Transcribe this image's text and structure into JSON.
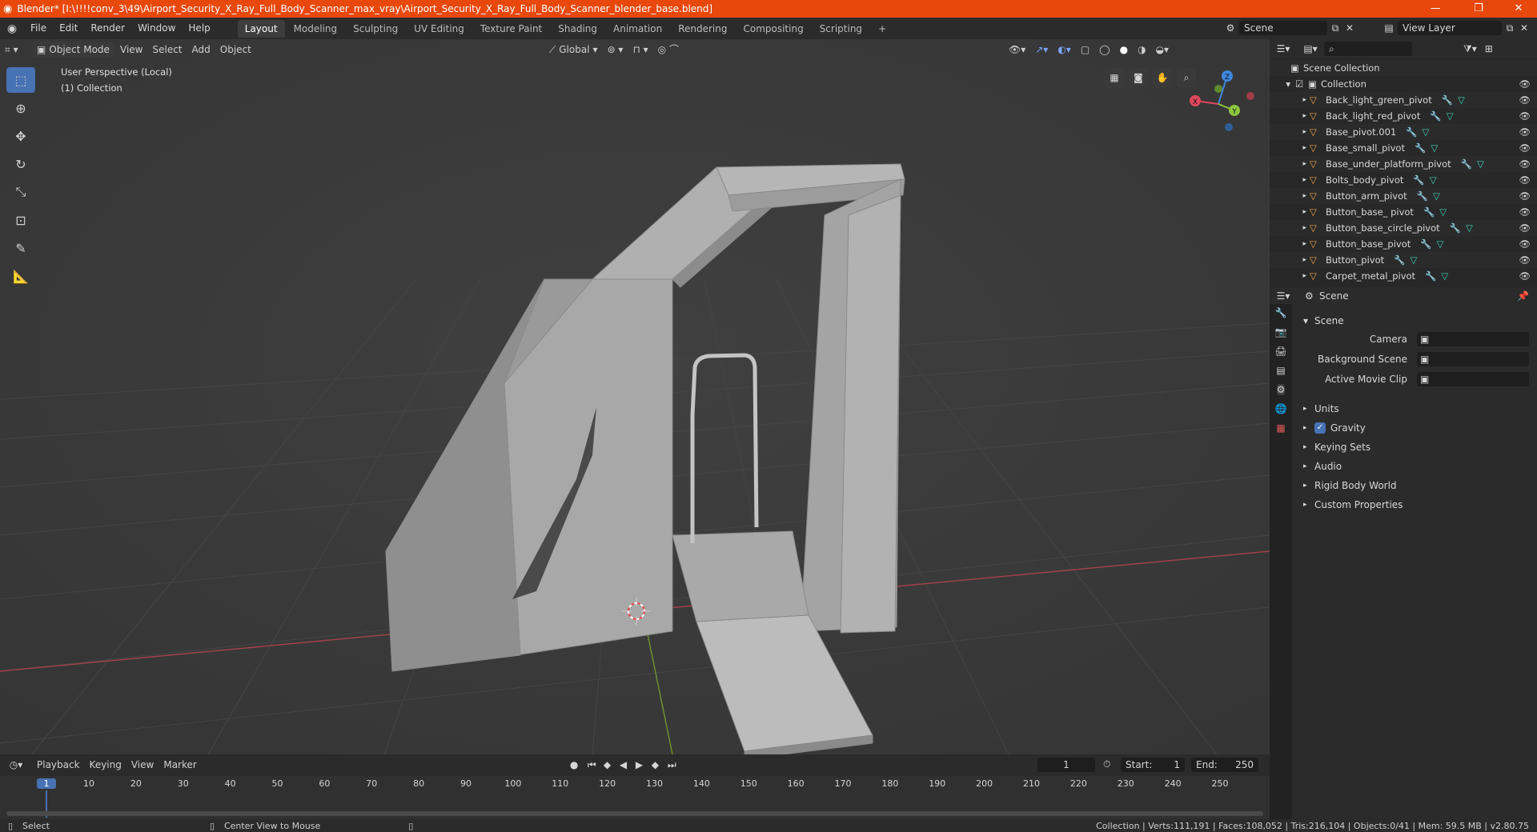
{
  "window": {
    "title": "Blender* [I:\\!!!!conv_3\\49\\Airport_Security_X_Ray_Full_Body_Scanner_max_vray\\Airport_Security_X_Ray_Full_Body_Scanner_blender_base.blend]",
    "minimize": "—",
    "restore": "❐",
    "close": "✕"
  },
  "menu": {
    "items": [
      "File",
      "Edit",
      "Render",
      "Window",
      "Help"
    ]
  },
  "workspaces": [
    {
      "label": "Layout",
      "active": true
    },
    {
      "label": "Modeling",
      "active": false
    },
    {
      "label": "Sculpting",
      "active": false
    },
    {
      "label": "UV Editing",
      "active": false
    },
    {
      "label": "Texture Paint",
      "active": false
    },
    {
      "label": "Shading",
      "active": false
    },
    {
      "label": "Animation",
      "active": false
    },
    {
      "label": "Rendering",
      "active": false
    },
    {
      "label": "Compositing",
      "active": false
    },
    {
      "label": "Scripting",
      "active": false
    }
  ],
  "add_workspace": "+",
  "scene_selector": {
    "value": "Scene"
  },
  "view_layer_selector": {
    "value": "View Layer"
  },
  "viewport_header": {
    "mode": "Object Mode",
    "menus": [
      "View",
      "Select",
      "Add",
      "Object"
    ],
    "orientation": "Global"
  },
  "viewport": {
    "perspective_label": "User Perspective (Local)",
    "collection_label": "(1) Collection",
    "gizmo_axes": {
      "x": "X",
      "y": "Y",
      "z": "Z"
    }
  },
  "outliner": {
    "search_placeholder": "",
    "scene_collection": "Scene Collection",
    "collection": "Collection",
    "objects": [
      "Back_light_green_pivot",
      "Back_light_red_pivot",
      "Base_pivot.001",
      "Base_small_pivot",
      "Base_under_platform_pivot",
      "Bolts_body_pivot",
      "Button_arm_pivot",
      "Button_base_ pivot",
      "Button_base_circle_pivot",
      "Button_base_pivot",
      "Button_pivot",
      "Carpet_metal_pivot"
    ]
  },
  "properties": {
    "context_title": "Scene",
    "panel_title": "Scene",
    "fields": [
      {
        "label": "Camera",
        "value": ""
      },
      {
        "label": "Background Scene",
        "value": ""
      },
      {
        "label": "Active Movie Clip",
        "value": ""
      }
    ],
    "sections": [
      {
        "label": "Units",
        "checkbox": false
      },
      {
        "label": "Gravity",
        "checkbox": true
      },
      {
        "label": "Keying Sets",
        "checkbox": false
      },
      {
        "label": "Audio",
        "checkbox": false
      },
      {
        "label": "Rigid Body World",
        "checkbox": false
      },
      {
        "label": "Custom Properties",
        "checkbox": false
      }
    ]
  },
  "timeline": {
    "menus": [
      "Playback",
      "Keying",
      "View",
      "Marker"
    ],
    "current_frame": "1",
    "start_label": "Start:",
    "start": "1",
    "end_label": "End:",
    "end": "250",
    "ruler": [
      "1",
      "10",
      "20",
      "30",
      "40",
      "50",
      "60",
      "70",
      "80",
      "90",
      "100",
      "110",
      "120",
      "130",
      "140",
      "150",
      "160",
      "170",
      "180",
      "190",
      "200",
      "210",
      "220",
      "230",
      "240",
      "250"
    ]
  },
  "status": {
    "left_action": "Select",
    "middle_action": "Center View to Mouse",
    "stats": "Collection | Verts:111,191 | Faces:108,052 | Tris:216,104 | Objects:0/41 | Mem: 59.5 MB | v2.80.75"
  },
  "colors": {
    "title_bar": "#e8480c",
    "active_tool": "#4772b3",
    "viewport_bg": "#3b3b3b",
    "panel_bg": "#2b2b2b",
    "axis_x": "#e0475c",
    "axis_y": "#8cc63f",
    "axis_z": "#3f88e0",
    "object_icon": "#f0a03c",
    "mesh_icon": "#3ad4b0",
    "modifier_icon": "#7aa7ff"
  }
}
